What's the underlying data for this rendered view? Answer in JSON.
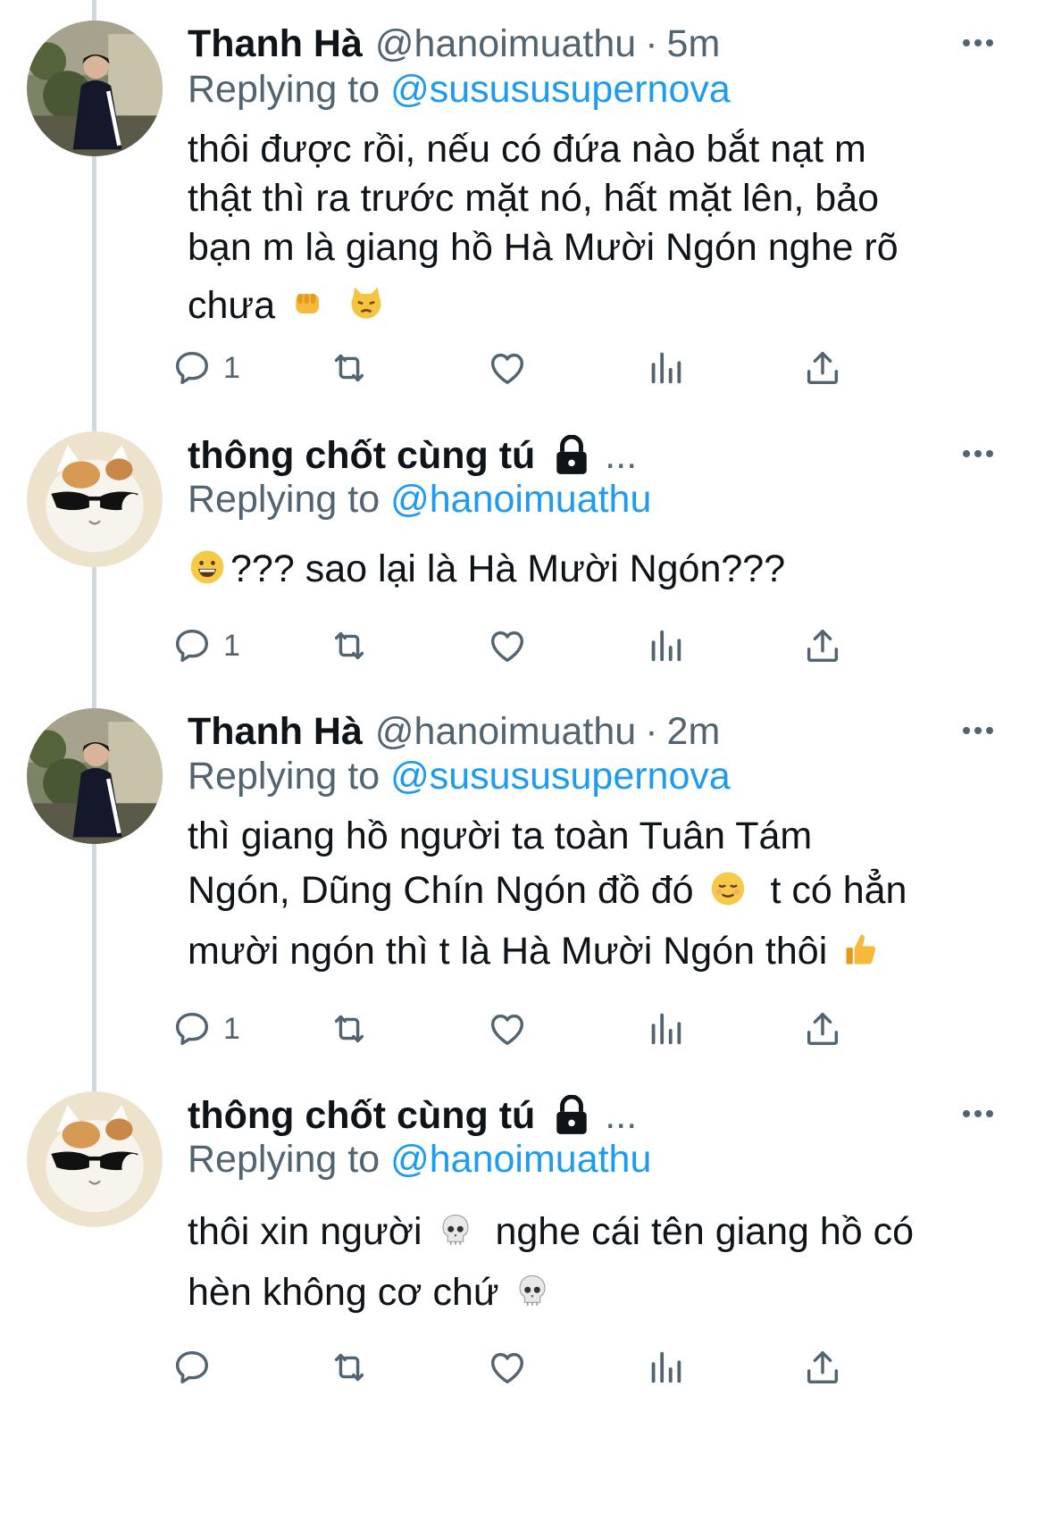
{
  "tweets": [
    {
      "display_name": "Thanh Hà",
      "handle": "@hanoimuathu",
      "time": "5m",
      "replying_label": "Replying to",
      "replying_to": "@susususupernova",
      "lines": [
        "thôi được rồi, nếu có đứa nào bắt nạt m",
        "thật thì ra trước mặt nó, hất mặt lên, bảo",
        "bạn m là giang hồ Hà Mười Ngón nghe rõ",
        "chưa"
      ],
      "reply_count": "1",
      "avatar": "boy-avatar"
    },
    {
      "display_name": "thông chốt cùng tú",
      "truncation": "...",
      "protected": true,
      "replying_label": "Replying to",
      "replying_to": "@hanoimuathu",
      "lines": [
        "??? sao lại là Hà Mười Ngón???"
      ],
      "reply_count": "1",
      "avatar": "cat-sunglasses-avatar"
    },
    {
      "display_name": "Thanh Hà",
      "handle": "@hanoimuathu",
      "time": "2m",
      "replying_label": "Replying to",
      "replying_to": "@susususupernova",
      "lines": [
        "thì giang hồ người ta toàn Tuân Tám",
        "Ngón, Dũng Chín Ngón đồ đó",
        "t có hẳn",
        "mười ngón thì t là Hà Mười Ngón thôi"
      ],
      "reply_count": "1",
      "avatar": "boy-avatar"
    },
    {
      "display_name": "thông chốt cùng tú",
      "truncation": "...",
      "protected": true,
      "replying_label": "Replying to",
      "replying_to": "@hanoimuathu",
      "lines": [
        "thôi xin người",
        "nghe cái tên giang hồ có",
        "hèn không cơ chứ"
      ],
      "reply_count": "",
      "avatar": "cat-sunglasses-avatar"
    }
  ],
  "icons": {
    "reply": "reply-bubble-icon",
    "retweet": "retweet-icon",
    "like": "heart-icon",
    "views": "views-bar-chart-icon",
    "share": "share-upload-icon",
    "more": "more-dots-icon",
    "lock": "lock-icon"
  },
  "emoji": {
    "fist": "fist-emoji",
    "pouting_cat": "pouting-cat-emoji",
    "grin": "grinning-face-emoji",
    "relieved": "relieved-face-emoji",
    "thumbs_up": "thumbs-up-emoji",
    "skull": "skull-emoji"
  },
  "colors": {
    "text": "#0f1419",
    "secondary": "#536471",
    "link": "#1d9bf0",
    "thread_line": "#cfd9de"
  }
}
